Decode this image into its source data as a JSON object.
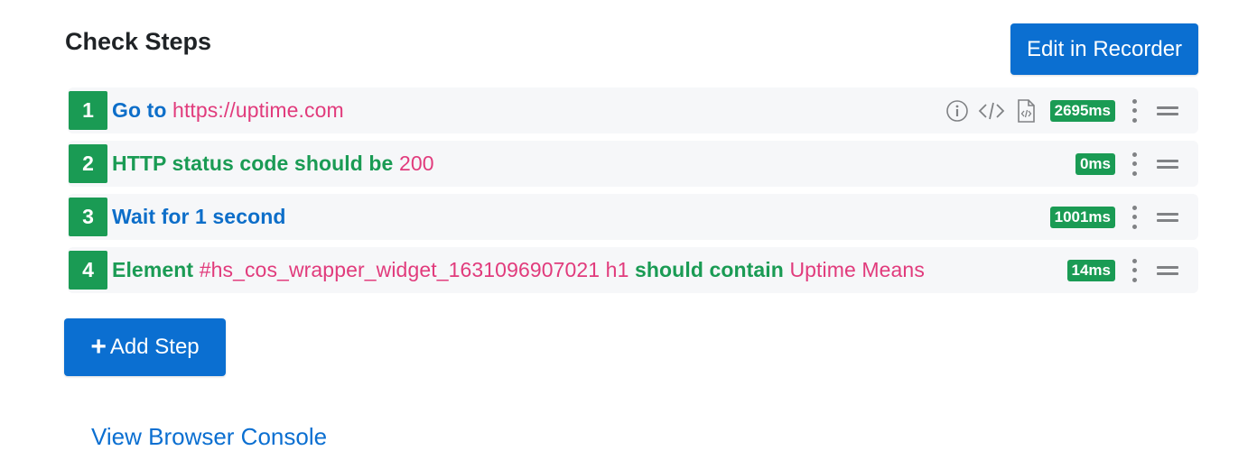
{
  "header": {
    "title": "Check Steps",
    "edit_recorder_label": "Edit in Recorder"
  },
  "icons": {
    "info": "info-circle-icon",
    "code": "code-icon",
    "file": "file-code-icon",
    "kebab": "kebab-menu-icon",
    "drag": "drag-handle-icon",
    "plus": "plus-icon"
  },
  "colors": {
    "accent_blue": "#0b6fd1",
    "step_green": "#1a9b54",
    "value_pink": "#e13b7c",
    "row_bg": "#f6f7f9"
  },
  "steps": [
    {
      "number": "1",
      "parts": [
        {
          "text": "Go to",
          "style": "kw-blue"
        },
        {
          "text": "https://uptime.com",
          "style": "val-pink"
        }
      ],
      "duration": "2695ms",
      "has_tools": true
    },
    {
      "number": "2",
      "parts": [
        {
          "text": "HTTP status code should be",
          "style": "kw-green"
        },
        {
          "text": "200",
          "style": "val-pink"
        }
      ],
      "duration": "0ms",
      "has_tools": false
    },
    {
      "number": "3",
      "parts": [
        {
          "text": "Wait for 1 second",
          "style": "kw-blue"
        }
      ],
      "duration": "1001ms",
      "has_tools": false
    },
    {
      "number": "4",
      "parts": [
        {
          "text": "Element",
          "style": "kw-green"
        },
        {
          "text": "#hs_cos_wrapper_widget_1631096907021 h1",
          "style": "val-pink"
        },
        {
          "text": "should contain",
          "style": "kw-green"
        },
        {
          "text": "Uptime Means",
          "style": "val-pink"
        }
      ],
      "duration": "14ms",
      "has_tools": false
    }
  ],
  "actions": {
    "add_step_label": "Add Step",
    "add_step_plus": "+",
    "view_console_label": "View Browser Console"
  }
}
